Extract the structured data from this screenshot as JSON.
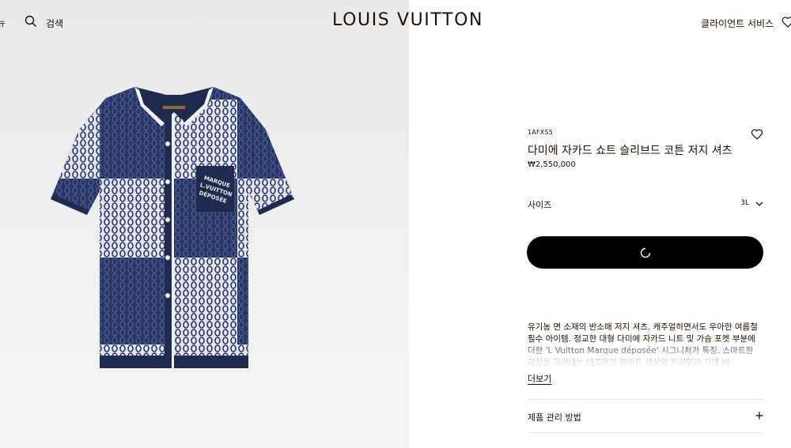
{
  "header": {
    "menu_fragment": "뉴",
    "search_label": "검색",
    "logo": "LOUIS VUITTON",
    "client_service": "클라이언트 서비스"
  },
  "product": {
    "sku": "1AFXS5",
    "name": "다미에 자카드 쇼트 슬리브드 코튼 저지 셔츠",
    "price": "₩2,550,000",
    "size_label": "사이즈",
    "size_value": "3L",
    "description": "유기농 면 소재의 반소매 저지 셔츠. 캐주얼하면서도 우아한 여름철 필수 아이템. 정교한 대형 다미에 자카드 니트 및 가슴 포켓 부분에 더한 'L Vuitton Marque déposée' 시그니처가 특징. 스마트한 감성을 자아내는 대조적인 화이트 색상의 트리밍과 자개 버",
    "more_label": "더보기",
    "care_label": "제품 관리 방법"
  },
  "image": {
    "pocket_text": "MARQUE L.VUITTON DÉPOSÉE"
  },
  "icons": {
    "search": "search-icon",
    "wishlist": "heart-icon",
    "size_dropdown": "chevron-down-icon",
    "loading": "spinner-icon",
    "expand": "plus-icon"
  },
  "colors": {
    "navy": "#1f2a4d",
    "white_knit": "#e9ecf4",
    "text": "#19110b",
    "button": "#000000"
  }
}
